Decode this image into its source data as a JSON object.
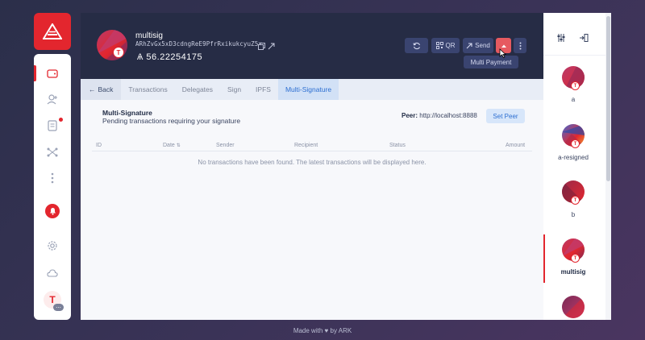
{
  "wallet": {
    "name": "multisig",
    "address": "ARhZvGx5xD3cdngReE9PfrRxikukcyuZ5x",
    "balance": "Ѧ 56.22254175",
    "avatar_letter": "T"
  },
  "header_buttons": {
    "qr_label": "QR",
    "send_label": "Send",
    "multi_payment_label": "Multi Payment"
  },
  "tabs": [
    {
      "label": "Back"
    },
    {
      "label": "Transactions"
    },
    {
      "label": "Delegates"
    },
    {
      "label": "Sign"
    },
    {
      "label": "IPFS"
    },
    {
      "label": "Multi-Signature"
    }
  ],
  "multisig_panel": {
    "title": "Multi-Signature",
    "subtitle": "Pending transactions requiring your signature",
    "peer_label": "Peer:",
    "peer_value": "http://localhost:8888",
    "set_peer_label": "Set Peer"
  },
  "table": {
    "columns": [
      "ID",
      "Date",
      "Sender",
      "Recipient",
      "Status",
      "Amount"
    ],
    "empty_message": "No transactions have been found. The latest transactions will be displayed here."
  },
  "wallets": [
    {
      "label": "a"
    },
    {
      "label": "a-resigned"
    },
    {
      "label": "b"
    },
    {
      "label": "multisig",
      "active": true
    },
    {
      "label": ""
    }
  ],
  "profile": {
    "letter": "T",
    "more": "..."
  },
  "footer": {
    "prefix": "Made with",
    "heart": "♥",
    "suffix": "by ARK"
  },
  "colors": {
    "accent": "#e3262e",
    "header_bg": "#262c45",
    "active_tab": "#2d6fd1"
  },
  "icons": [
    "ark-logo-icon",
    "wallet-icon",
    "contacts-icon",
    "transfer-icon",
    "network-icon",
    "more-icon",
    "bell-icon",
    "gear-icon",
    "cloud-icon",
    "refresh-icon",
    "qr-icon",
    "send-arrow-icon",
    "receive-icon",
    "kebab-icon",
    "copy-icon",
    "link-icon",
    "sliders-icon",
    "import-icon",
    "sort-icon"
  ]
}
